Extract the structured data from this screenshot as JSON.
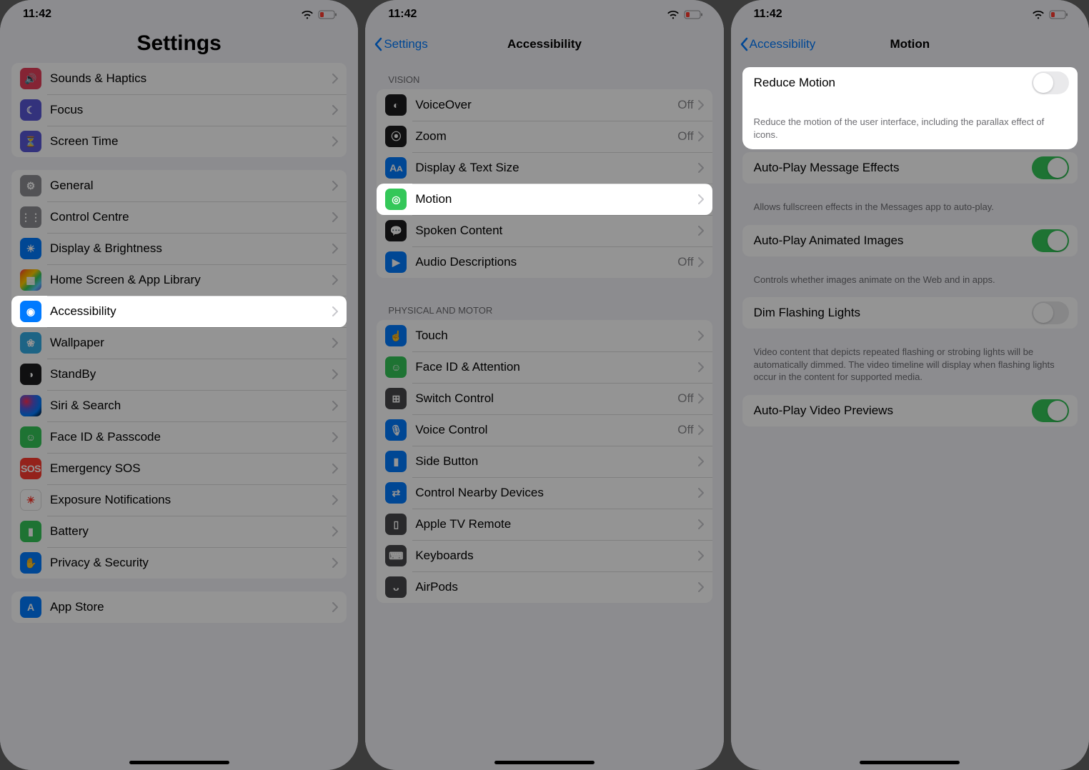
{
  "status": {
    "time": "11:42"
  },
  "screen1": {
    "title": "Settings",
    "groups": [
      {
        "rows": [
          {
            "icon": "sound-icon",
            "color": "icon-pink",
            "glyph": "🔊",
            "label": "Sounds & Haptics"
          },
          {
            "icon": "focus-icon",
            "color": "icon-indigo",
            "glyph": "☾",
            "label": "Focus"
          },
          {
            "icon": "screentime-icon",
            "color": "icon-indigo",
            "glyph": "⏳",
            "label": "Screen Time"
          }
        ]
      },
      {
        "rows": [
          {
            "icon": "general-icon",
            "color": "icon-gray",
            "glyph": "⚙",
            "label": "General"
          },
          {
            "icon": "control-centre-icon",
            "color": "icon-gray",
            "glyph": "⋮⋮",
            "label": "Control Centre"
          },
          {
            "icon": "display-icon",
            "color": "icon-blue",
            "glyph": "☀",
            "label": "Display & Brightness"
          },
          {
            "icon": "home-screen-icon",
            "color": "icon-rainbow",
            "glyph": "▦",
            "label": "Home Screen & App Library"
          },
          {
            "icon": "accessibility-icon",
            "color": "icon-blue",
            "glyph": "◉",
            "label": "Accessibility",
            "highlight": true
          },
          {
            "icon": "wallpaper-icon",
            "color": "icon-cyan",
            "glyph": "❀",
            "label": "Wallpaper"
          },
          {
            "icon": "standby-icon",
            "color": "icon-black",
            "glyph": "◑",
            "label": "StandBy"
          },
          {
            "icon": "siri-icon",
            "color": "icon-siri",
            "glyph": "",
            "label": "Siri & Search"
          },
          {
            "icon": "faceid-icon",
            "color": "icon-green",
            "glyph": "☺",
            "label": "Face ID & Passcode"
          },
          {
            "icon": "sos-icon",
            "color": "icon-sos",
            "glyph": "SOS",
            "label": "Emergency SOS"
          },
          {
            "icon": "exposure-icon",
            "color": "icon-white",
            "glyph": "☀",
            "label": "Exposure Notifications"
          },
          {
            "icon": "battery-icon",
            "color": "icon-green",
            "glyph": "▮",
            "label": "Battery"
          },
          {
            "icon": "privacy-icon",
            "color": "icon-blue",
            "glyph": "✋",
            "label": "Privacy & Security"
          }
        ]
      },
      {
        "rows": [
          {
            "icon": "appstore-icon",
            "color": "icon-blue",
            "glyph": "A",
            "label": "App Store"
          }
        ]
      }
    ]
  },
  "screen2": {
    "back": "Settings",
    "title": "Accessibility",
    "sections": [
      {
        "header": "Vision",
        "rows": [
          {
            "icon": "voiceover-icon",
            "color": "icon-black",
            "glyph": "◐",
            "label": "VoiceOver",
            "detail": "Off"
          },
          {
            "icon": "zoom-icon",
            "color": "icon-black",
            "glyph": "⦿",
            "label": "Zoom",
            "detail": "Off"
          },
          {
            "icon": "textsize-icon",
            "color": "icon-blue",
            "glyph": "Aᴀ",
            "label": "Display & Text Size"
          },
          {
            "icon": "motion-icon",
            "color": "icon-green",
            "glyph": "◎",
            "label": "Motion",
            "highlight": true
          },
          {
            "icon": "spoken-icon",
            "color": "icon-black",
            "glyph": "💬",
            "label": "Spoken Content"
          },
          {
            "icon": "audiodesc-icon",
            "color": "icon-blue",
            "glyph": "▶",
            "label": "Audio Descriptions",
            "detail": "Off"
          }
        ]
      },
      {
        "header": "Physical and Motor",
        "rows": [
          {
            "icon": "touch-icon",
            "color": "icon-blue",
            "glyph": "☝",
            "label": "Touch"
          },
          {
            "icon": "faceid2-icon",
            "color": "icon-green",
            "glyph": "☺",
            "label": "Face ID & Attention"
          },
          {
            "icon": "switch-icon",
            "color": "icon-darkgray",
            "glyph": "⊞",
            "label": "Switch Control",
            "detail": "Off"
          },
          {
            "icon": "voicecontrol-icon",
            "color": "icon-blue",
            "glyph": "🎙",
            "label": "Voice Control",
            "detail": "Off"
          },
          {
            "icon": "sidebutton-icon",
            "color": "icon-blue",
            "glyph": "▮",
            "label": "Side Button"
          },
          {
            "icon": "nearby-icon",
            "color": "icon-blue",
            "glyph": "⇄",
            "label": "Control Nearby Devices"
          },
          {
            "icon": "appletv-icon",
            "color": "icon-darkgray",
            "glyph": "▯",
            "label": "Apple TV Remote"
          },
          {
            "icon": "keyboards-icon",
            "color": "icon-darkgray",
            "glyph": "⌨",
            "label": "Keyboards"
          },
          {
            "icon": "airpods-icon",
            "color": "icon-darkgray",
            "glyph": "ᴗ",
            "label": "AirPods"
          }
        ]
      }
    ]
  },
  "screen3": {
    "back": "Accessibility",
    "title": "Motion",
    "rows": [
      {
        "label": "Reduce Motion",
        "toggle": "off",
        "footer": "Reduce the motion of the user interface, including the parallax effect of icons.",
        "highlight": true
      },
      {
        "label": "Auto-Play Message Effects",
        "toggle": "on",
        "footer": "Allows fullscreen effects in the Messages app to auto-play."
      },
      {
        "label": "Auto-Play Animated Images",
        "toggle": "on",
        "footer": "Controls whether images animate on the Web and in apps."
      },
      {
        "label": "Dim Flashing Lights",
        "toggle": "off",
        "footer": "Video content that depicts repeated flashing or strobing lights will be automatically dimmed. The video timeline will display when flashing lights occur in the content for supported media."
      },
      {
        "label": "Auto-Play Video Previews",
        "toggle": "on"
      }
    ]
  }
}
